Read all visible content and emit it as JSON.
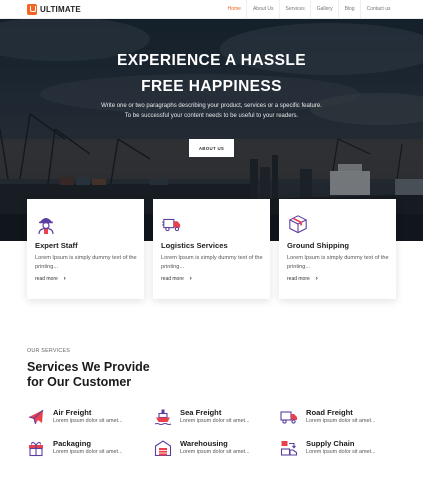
{
  "header": {
    "logo_text": "ULTIMATE",
    "nav": [
      "Home",
      "About Us",
      "Services",
      "Gallery",
      "Blog",
      "Contact us"
    ],
    "active_nav": "Home"
  },
  "hero": {
    "title_line1": "EXPERIENCE A HASSLE",
    "title_line2": "FREE HAPPINESS",
    "subtitle_line1": "Write one or two paragraphs describing your product, services or a specific feature.",
    "subtitle_line2": "To be successful your content needs to be useful to your readers.",
    "button_label": "ABOUT US"
  },
  "features": [
    {
      "title": "Expert Staff",
      "desc": "Lorem Ipsum is simply dummy text of the printing...",
      "link": "read more",
      "icon": "worker-icon"
    },
    {
      "title": "Logistics Services",
      "desc": "Lorem Ipsum is simply dummy text of the printing...",
      "link": "read more",
      "icon": "delivery-truck-icon"
    },
    {
      "title": "Ground Shipping",
      "desc": "Lorem Ipsum is simply dummy text of the printing...",
      "link": "read more",
      "icon": "package-box-icon"
    }
  ],
  "services": {
    "eyebrow": "OUR SERVICES",
    "heading_line1": "Services We Provide",
    "heading_line2": "for Our Customer",
    "items": [
      {
        "name": "Air Freight",
        "desc": "Lorem ipsum dolor sit amet...",
        "icon": "airplane-icon"
      },
      {
        "name": "Sea Freight",
        "desc": "Lorem ipsum dolor sit amet...",
        "icon": "ship-icon"
      },
      {
        "name": "Road Freight",
        "desc": "Lorem ipsum dolor sit amet...",
        "icon": "truck-icon"
      },
      {
        "name": "Packaging",
        "desc": "Lorem ipsum dolor sit amet...",
        "icon": "gift-box-icon"
      },
      {
        "name": "Warehousing",
        "desc": "Lorem ipsum dolor sit amet...",
        "icon": "warehouse-icon"
      },
      {
        "name": "Supply Chain",
        "desc": "Lorem ipsum dolor sit amet...",
        "icon": "supply-chain-icon"
      }
    ]
  },
  "colors": {
    "accent": "#f26522",
    "icon_purple": "#5b3fa0",
    "icon_red": "#e8414d"
  }
}
